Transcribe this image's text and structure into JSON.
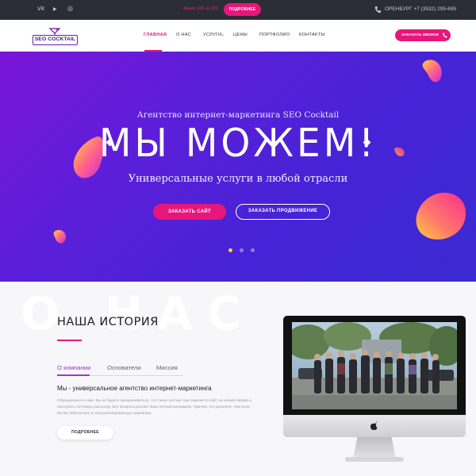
{
  "topbar": {
    "social": [
      "vk-icon",
      "youtube-icon",
      "instagram-icon"
    ],
    "social_glyphs": [
      "vk",
      "▶",
      "◎"
    ],
    "promo_text": "Акция 100 за 100",
    "promo_button": "ПОДРОБНЕЕ",
    "contact": "ОРЕНБУРГ +7 (3532) 295-695"
  },
  "nav": {
    "logo_text": "SEO COCKTAIL",
    "items": [
      "ГЛАВНАЯ",
      "О НАС",
      "УСЛУГИ",
      "ЦЕНЫ",
      "ПОРТФОЛИО",
      "КОНТАКТЫ"
    ],
    "active": "ГЛАВНАЯ",
    "dropdown_caret": "⌄",
    "call_button": "ЗАКАЗАТЬ ЗВОНОК"
  },
  "hero": {
    "subtitle": "Агентство интернет-маркетинга SEO Cocktail",
    "headline": "МЫ МОЖЕМ!",
    "tagline": "Универсальные услуги в любой отрасли",
    "primary_button": "ЗАКАЗАТЬ САЙТ",
    "secondary_button": "ЗАКАЗАТЬ ПРОДВИЖЕНИЕ",
    "slides": 3,
    "active_slide": 1
  },
  "about": {
    "ghost_text": "О НАС",
    "heading": "НАША ИСТОРИЯ",
    "tabs": [
      "О компании",
      "Основатели",
      "Миссия"
    ],
    "active_tab": "О компании",
    "subheading": "Мы - универсальное агентство интернет-маркетинга",
    "paragraph": "Обращаешься к нам. Вы не будете заморачиваться, что такое хостинг, как перенести сайт на новый сервер и настроить почтовую рассылку. Все вопросы решает Ваш личный менеджер. Причем, это дешевле, чем если бы Вы обратились в специализированную компанию.",
    "more_button": "ПОДРОБНЕЕ"
  },
  "colors": {
    "accent": "#e5177a",
    "hero_start": "#7a15d8",
    "hero_end": "#3a2ad2",
    "topbar": "#2b2d36"
  }
}
